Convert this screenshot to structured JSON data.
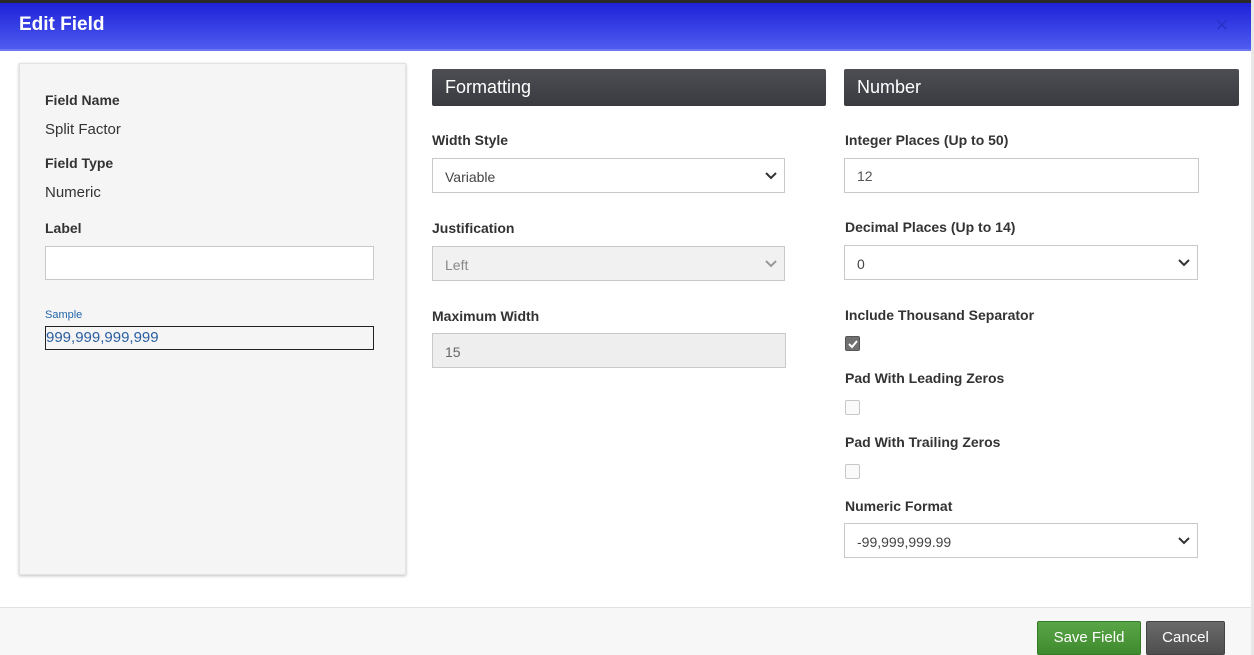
{
  "dialog": {
    "title": "Edit Field"
  },
  "left": {
    "field_name_label": "Field Name",
    "field_name_value": "Split Factor",
    "field_type_label": "Field Type",
    "field_type_value": "Numeric",
    "label_label": "Label",
    "label_value": "",
    "sample_label": "Sample",
    "sample_value": "999,999,999,999"
  },
  "formatting": {
    "heading": "Formatting",
    "width_style_label": "Width Style",
    "width_style_value": "Variable",
    "justification_label": "Justification",
    "justification_value": "Left",
    "max_width_label": "Maximum Width",
    "max_width_value": "15"
  },
  "number": {
    "heading": "Number",
    "integer_label": "Integer Places (Up to 50)",
    "integer_value": "12",
    "decimal_label": "Decimal Places (Up to 14)",
    "decimal_value": "0",
    "thousand_label": "Include Thousand Separator",
    "thousand_checked": true,
    "leading_label": "Pad With Leading Zeros",
    "leading_checked": false,
    "trailing_label": "Pad With Trailing Zeros",
    "trailing_checked": false,
    "numeric_format_label": "Numeric Format",
    "numeric_format_value": "-99,999,999.99"
  },
  "footer": {
    "save_label": "Save Field",
    "cancel_label": "Cancel"
  },
  "icons": {
    "close": "close-icon",
    "chevron": "chevron-down-icon",
    "check": "check-icon"
  },
  "colors": {
    "titlebar": "#2b35e0",
    "save": "#4a9638",
    "cancel": "#5a5a5a",
    "section_head": "#424449"
  }
}
